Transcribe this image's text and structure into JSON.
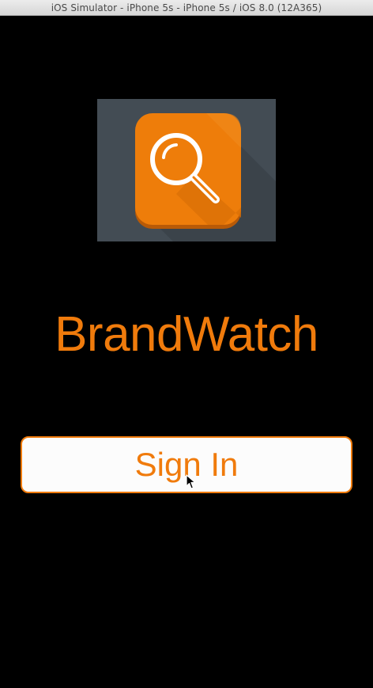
{
  "window": {
    "title": "iOS Simulator - iPhone 5s - iPhone 5s / iOS 8.0 (12A365)"
  },
  "app": {
    "name": "BrandWatch",
    "logo_icon": "magnifying-glass-icon",
    "signin_label": "Sign In"
  },
  "colors": {
    "accent": "#f07b0c",
    "logo_background": "#434c54",
    "screen_background": "#000000",
    "button_background": "#fcfcfc"
  }
}
